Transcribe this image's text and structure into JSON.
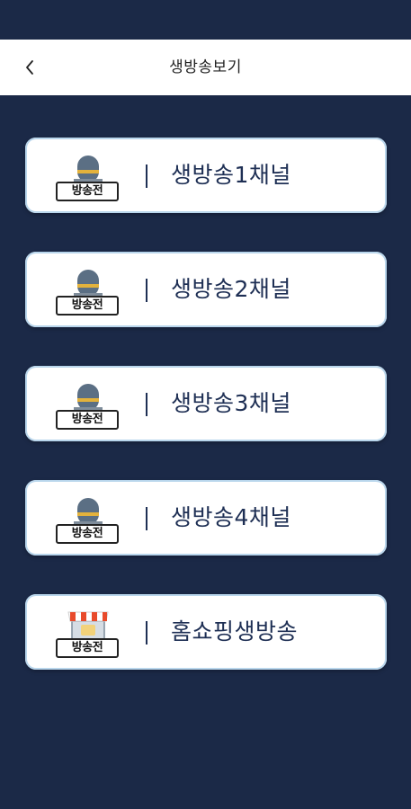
{
  "header": {
    "title": "생방송보기",
    "back_icon": "chevron-left-icon"
  },
  "channels": [
    {
      "label": "생방송1채널",
      "badge": "방송전",
      "icon": "microphone-icon"
    },
    {
      "label": "생방송2채널",
      "badge": "방송전",
      "icon": "microphone-icon"
    },
    {
      "label": "생방송3채널",
      "badge": "방송전",
      "icon": "microphone-icon"
    },
    {
      "label": "생방송4채널",
      "badge": "방송전",
      "icon": "microphone-icon"
    },
    {
      "label": "홈쇼핑생방송",
      "badge": "방송전",
      "icon": "shop-icon"
    }
  ],
  "colors": {
    "background": "#1b2947",
    "header": "#ffffff",
    "card": "#ffffff",
    "card_border": "#b9d6ec",
    "label_text": "#1e2f54",
    "mic_body": "#5b6f84",
    "mic_band": "#e3b23c",
    "awning_red": "#e84b2c"
  }
}
